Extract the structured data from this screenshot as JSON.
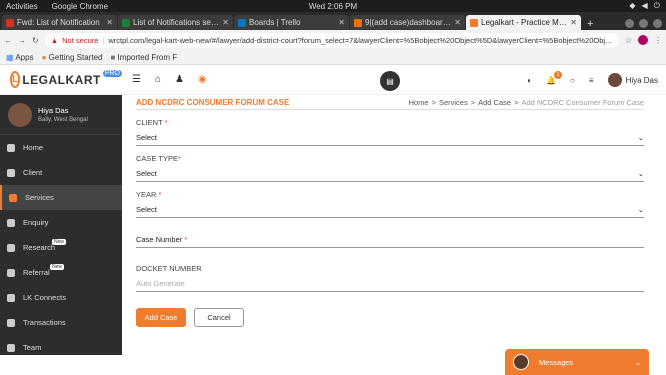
{
  "os": {
    "activities": "Activities",
    "app": "Google Chrome",
    "clock": "Wed  2:06 PM"
  },
  "tabs": [
    {
      "title": "Fwd: List of Notification",
      "color": "#d93025"
    },
    {
      "title": "List of Notifications seen",
      "color": "#188038"
    },
    {
      "title": "Boards | Trello",
      "color": "#0079bf"
    },
    {
      "title": "9|(add case)dashboard>c",
      "color": "#e8710a"
    },
    {
      "title": "Legalkart - Practice Mana",
      "color": "#f07c2e"
    }
  ],
  "toolbar": {
    "not_secure": "Not secure",
    "url": "wrctpl.com/legal-kart-web-new/#/lawyer/add-district-court?forum_select=7&lawyerClient=%5Bobject%20Object%5D&lawyerClient=%5Bobject%20Obj..."
  },
  "bookmarks": {
    "apps": "Apps",
    "getting_started": "Getting Started",
    "imported": "Imported From F"
  },
  "header": {
    "logo": "LEGALKART",
    "pro": "PRO",
    "badge_count": "1",
    "user_name": "Hiya Das"
  },
  "sidebar": {
    "profile_name": "Hiya Das",
    "profile_location": "Bally, West Bengal",
    "new_badge": "New",
    "items": [
      "Home",
      "Client",
      "Services",
      "Enquiry",
      "Research",
      "Referral",
      "LK Connects",
      "Transactions",
      "Team"
    ]
  },
  "page": {
    "title": "ADD NCDRC CONSUMER FORUM CASE",
    "breadcrumb": [
      "Home",
      "Services",
      "Add Case",
      "Add NCDRC Consumer Forum Case"
    ]
  },
  "form": {
    "client_label": "CLIENT",
    "client_value": "Select",
    "case_type_label": "CASE TYPE",
    "case_type_value": "Select",
    "year_label": "YEAR",
    "year_value": "Select",
    "case_number_label": "Case Number",
    "docket_label": "DOCKET NUMBER",
    "docket_placeholder": "Auto Generate",
    "add_button": "Add Case",
    "cancel_button": "Cancel"
  },
  "messages": {
    "label": "Messages"
  },
  "colors": {
    "accent": "#f07c2e",
    "sidebar": "#2d2d2d"
  }
}
